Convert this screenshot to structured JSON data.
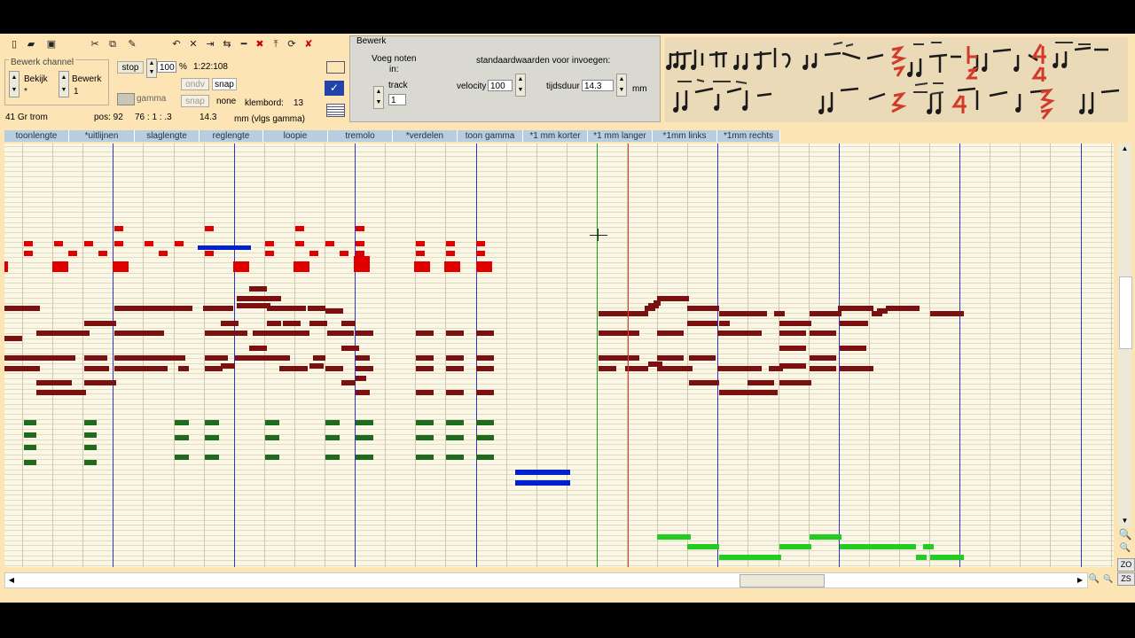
{
  "toolbar": {
    "icons": [
      "new-file-icon",
      "open-folder-icon",
      "save-icon",
      "cut-icon",
      "copy-icon",
      "paste-icon",
      "undo-icon",
      "delete-icon",
      "arrow-right-icon",
      "swap-icon",
      "line-icon",
      "split-icon",
      "insert-icon",
      "refresh-icon",
      "delete-red-icon"
    ]
  },
  "channel": {
    "group_title": "Bewerk channel",
    "bekijk_label": "Bekijk",
    "bekijk_value": "*",
    "bewerk_label": "Bewerk",
    "bewerk_value": "1"
  },
  "transport": {
    "stop_label": "stop",
    "tempo_value": "100",
    "percent": "%",
    "time": "1:22:108",
    "ondv_label": "ondv",
    "snap_label": "snap",
    "gamma_label": "gamma",
    "snap2_label": "snap",
    "none_label": "none",
    "klembord_label": "klembord:",
    "klembord_value": "13"
  },
  "status": {
    "instrument": "41  Gr trom",
    "pos_label": "pos: 92",
    "position": "76 :  1 : .3",
    "length": "14.3",
    "unit_note": "mm  (vlgs gamma)"
  },
  "bewerk": {
    "title": "Bewerk",
    "voeg_label": "Voeg noten\nin:",
    "track_label": "track",
    "track_value": "1",
    "defaults_label": "standaardwaarden voor invoegen:",
    "velocity_label": "velocity",
    "velocity_value": "100",
    "duration_label": "tijdsduur",
    "duration_value": "14.3",
    "mm_label": "mm"
  },
  "tabs": [
    "toonlengte",
    "*uitlijnen",
    "slaglengte",
    "reglengte",
    "loopie",
    "tremolo",
    "*verdelen",
    "toon gamma",
    "*1 mm korter",
    "*1 mm langer",
    "*1mm links",
    "*1mm rechts"
  ],
  "side_buttons": [
    "ZO",
    "ZS"
  ],
  "colors": {
    "drum": "#e00000",
    "brass": "#7a1010",
    "woodwind": "#1e6b1e",
    "selected": "#0022cc",
    "lead": "#22cc22",
    "beat_line": "#3333cc",
    "playhead": "#e23b3b",
    "cursor": "#1a9a1a"
  }
}
